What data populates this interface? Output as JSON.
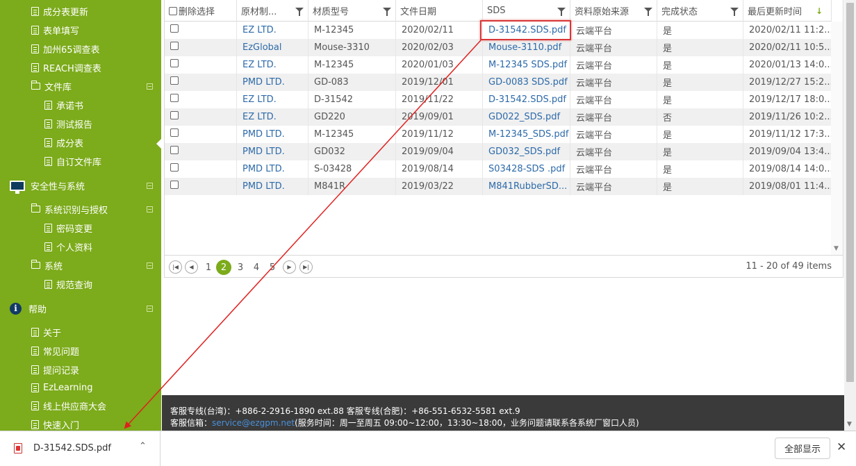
{
  "sidebar": {
    "items": [
      {
        "label": "成分表更新",
        "icon": "doc-icon",
        "kind": "leaf",
        "indent": 1
      },
      {
        "label": "表单填写",
        "icon": "doc-icon",
        "kind": "leaf",
        "indent": 1
      },
      {
        "label": "加州65调查表",
        "icon": "doc-icon",
        "kind": "leaf",
        "indent": 1
      },
      {
        "label": "REACH调查表",
        "icon": "doc-icon",
        "kind": "leaf",
        "indent": 1
      },
      {
        "label": "文件库",
        "icon": "folder-icon",
        "kind": "folder",
        "indent": 1
      },
      {
        "label": "承诺书",
        "icon": "doc-icon",
        "kind": "leaf",
        "indent": 2
      },
      {
        "label": "测试报告",
        "icon": "doc-icon",
        "kind": "leaf",
        "indent": 2
      },
      {
        "label": "成分表",
        "icon": "doc-icon",
        "kind": "leaf",
        "indent": 2
      },
      {
        "label": "自订文件库",
        "icon": "doc-icon",
        "kind": "leaf",
        "indent": 2
      },
      {
        "label": "安全性与系统",
        "icon": "monitor-icon",
        "kind": "section",
        "indent": 0
      },
      {
        "label": "系统识别与授权",
        "icon": "folder-icon",
        "kind": "folder",
        "indent": 1
      },
      {
        "label": "密码变更",
        "icon": "doc-icon",
        "kind": "leaf",
        "indent": 2
      },
      {
        "label": "个人资料",
        "icon": "doc-icon",
        "kind": "leaf",
        "indent": 2
      },
      {
        "label": "系统",
        "icon": "folder-icon",
        "kind": "folder",
        "indent": 1
      },
      {
        "label": "规范查询",
        "icon": "doc-icon",
        "kind": "leaf",
        "indent": 2
      },
      {
        "label": "帮助",
        "icon": "info-icon",
        "kind": "section",
        "indent": 0
      },
      {
        "label": "关于",
        "icon": "doc-icon",
        "kind": "leaf",
        "indent": 1
      },
      {
        "label": "常见问题",
        "icon": "doc-icon",
        "kind": "leaf",
        "indent": 1
      },
      {
        "label": "提问记录",
        "icon": "doc-icon",
        "kind": "leaf",
        "indent": 1
      },
      {
        "label": "EzLearning",
        "icon": "doc-icon",
        "kind": "leaf",
        "indent": 1
      },
      {
        "label": "线上供应商大会",
        "icon": "doc-icon",
        "kind": "leaf",
        "indent": 1
      },
      {
        "label": "快速入门",
        "icon": "doc-icon",
        "kind": "leaf",
        "indent": 1
      }
    ]
  },
  "grid": {
    "columns": [
      {
        "label": "删除选择",
        "filter": false,
        "checkbox": true
      },
      {
        "label": "原材制...",
        "filter": true
      },
      {
        "label": "材质型号",
        "filter": true
      },
      {
        "label": "文件日期",
        "filter": false
      },
      {
        "label": "SDS",
        "filter": true
      },
      {
        "label": "资料原始来源",
        "filter": true
      },
      {
        "label": "完成状态",
        "filter": true
      },
      {
        "label": "最后更新时间",
        "filter": false,
        "sort": "↓"
      }
    ],
    "rows": [
      {
        "supplier": "EZ LTD.",
        "model": "M-12345",
        "date": "2020/02/11",
        "sds": "D-31542.SDS.pdf",
        "source": "云端平台",
        "status": "是",
        "updated": "2020/02/11 11:2..."
      },
      {
        "supplier": "EzGlobal",
        "model": "Mouse-3310",
        "date": "2020/02/03",
        "sds": "Mouse-3110.pdf",
        "source": "云端平台",
        "status": "是",
        "updated": "2020/02/11 10:5..."
      },
      {
        "supplier": "EZ LTD.",
        "model": "M-12345",
        "date": "2020/01/03",
        "sds": "M-12345 SDS.pdf",
        "source": "云端平台",
        "status": "是",
        "updated": "2020/01/13 14:0..."
      },
      {
        "supplier": "PMD LTD.",
        "model": "GD-083",
        "date": "2019/12/01",
        "sds": "GD-0083 SDS.pdf",
        "source": "云端平台",
        "status": "是",
        "updated": "2019/12/27 15:2..."
      },
      {
        "supplier": "EZ LTD.",
        "model": "D-31542",
        "date": "2019/11/22",
        "sds": "D-31542.SDS.pdf",
        "source": "云端平台",
        "status": "是",
        "updated": "2019/12/17 18:0..."
      },
      {
        "supplier": "EZ LTD.",
        "model": "GD220",
        "date": "2019/09/01",
        "sds": "GD022_SDS.pdf",
        "source": "云端平台",
        "status": "否",
        "updated": "2019/11/26 10:2..."
      },
      {
        "supplier": "PMD LTD.",
        "model": "M-12345",
        "date": "2019/11/12",
        "sds": "M-12345_SDS.pdf",
        "source": "云端平台",
        "status": "是",
        "updated": "2019/11/12 17:3..."
      },
      {
        "supplier": "PMD LTD.",
        "model": "GD032",
        "date": "2019/09/04",
        "sds": "GD032_SDS.pdf",
        "source": "云端平台",
        "status": "是",
        "updated": "2019/09/04 13:4..."
      },
      {
        "supplier": "PMD LTD.",
        "model": "S-03428",
        "date": "2019/08/14",
        "sds": "S03428-SDS .pdf",
        "source": "云端平台",
        "status": "是",
        "updated": "2019/08/14 14:0..."
      },
      {
        "supplier": "PMD LTD.",
        "model": "M841R",
        "date": "2019/03/22",
        "sds": "M841RubberSD...",
        "source": "云端平台",
        "status": "是",
        "updated": "2019/08/01 11:4..."
      }
    ]
  },
  "pager": {
    "pages": [
      "1",
      "2",
      "3",
      "4",
      "5"
    ],
    "active_page": "2",
    "info": "11 - 20 of 49 items"
  },
  "footer": {
    "line1": "客服专线(台湾)：+886-2-2916-1890 ext.88 客服专线(合肥)：+86-551-6532-5581 ext.9",
    "email_label": "客服信箱：",
    "email": "service@ezgpm.net",
    "hours": "(服务时间：周一至周五 09:00~12:00，13:30~18:00，业务问题请联系各系统厂窗口人员)"
  },
  "download_bar": {
    "file_name": "D-31542.SDS.pdf",
    "show_all_label": "全部显示",
    "close_glyph": "✕",
    "chevron_glyph": "⌃"
  },
  "colors": {
    "sidebar": "#7cab1b",
    "link": "#2d6aa9",
    "highlight": "#d93636",
    "footer": "#3a3a3a"
  }
}
